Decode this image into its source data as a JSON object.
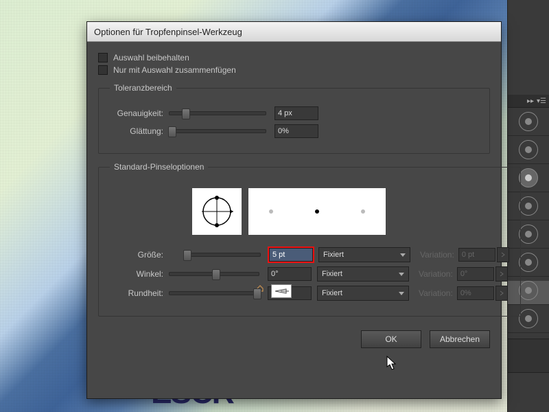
{
  "dialog": {
    "title": "Optionen für Tropfenpinsel-Werkzeug",
    "keepSelection": "Auswahl beibehalten",
    "mergeSelection": "Nur mit Auswahl zusammenfügen",
    "tolerance": {
      "legend": "Toleranzbereich",
      "accuracyLabel": "Genauigkeit:",
      "accuracyValue": "4 px",
      "smoothLabel": "Glättung:",
      "smoothValue": "0%"
    },
    "brush": {
      "legend": "Standard-Pinseloptionen",
      "sizeLabel": "Größe:",
      "sizeValue": "5 pt",
      "sizeMode": "Fixiert",
      "sizeVarLabel": "Variation:",
      "sizeVarValue": "0 pt",
      "angleLabel": "Winkel:",
      "angleValue": "0°",
      "angleMode": "Fixiert",
      "angleVarLabel": "Variation:",
      "angleVarValue": "0°",
      "roundLabel": "Rundheit:",
      "roundValue": "100%",
      "roundMode": "Fixiert",
      "roundVarLabel": "Variation:",
      "roundVarValue": "0%"
    },
    "ok": "OK",
    "cancel": "Abbrechen"
  },
  "bgText": "ESCR"
}
